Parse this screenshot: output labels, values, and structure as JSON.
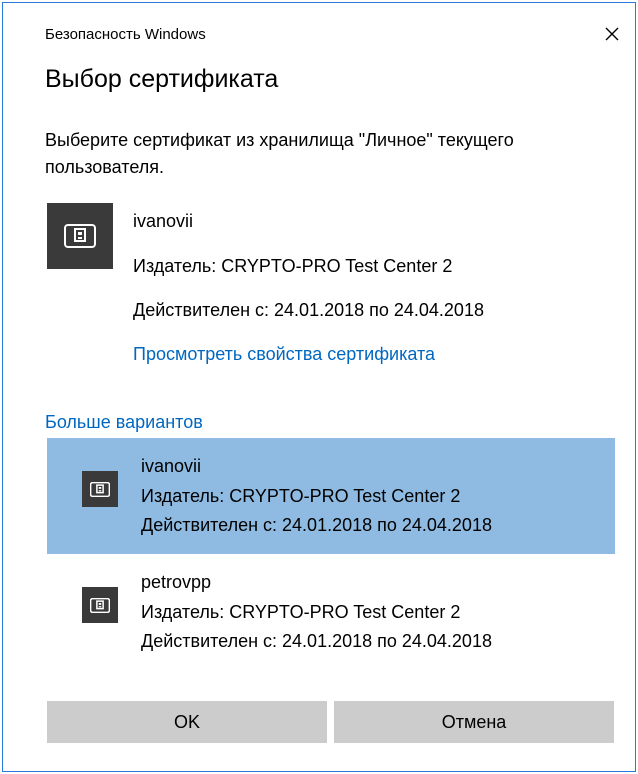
{
  "window": {
    "title": "Безопасность Windows",
    "close_icon": "close-icon"
  },
  "dialog": {
    "heading": "Выбор сертификата",
    "instruction": "Выберите сертификат из хранилища \"Личное\" текущего пользователя."
  },
  "selected_certificate": {
    "name": "ivanovii",
    "issuer": "Издатель: CRYPTO-PRO Test Center 2",
    "validity": "Действителен с: 24.01.2018 по 24.04.2018",
    "view_link": "Просмотреть свойства сертификата",
    "icon": "certificate-icon"
  },
  "more_options": {
    "label": "Больше вариантов",
    "items": [
      {
        "name": "ivanovii",
        "issuer": "Издатель: CRYPTO-PRO Test Center 2",
        "validity": "Действителен с: 24.01.2018 по 24.04.2018",
        "selected": true,
        "icon": "certificate-icon"
      },
      {
        "name": "petrovpp",
        "issuer": "Издатель: CRYPTO-PRO Test Center 2",
        "validity": "Действителен с: 24.01.2018 по 24.04.2018",
        "selected": false,
        "icon": "certificate-icon"
      }
    ]
  },
  "buttons": {
    "ok": "OK",
    "cancel": "Отмена"
  },
  "colors": {
    "accent": "#0067c0",
    "selection": "#8fbbe2",
    "button": "#cccccc",
    "icon_bg": "#3a3a3a",
    "border": "#2b79d8"
  }
}
